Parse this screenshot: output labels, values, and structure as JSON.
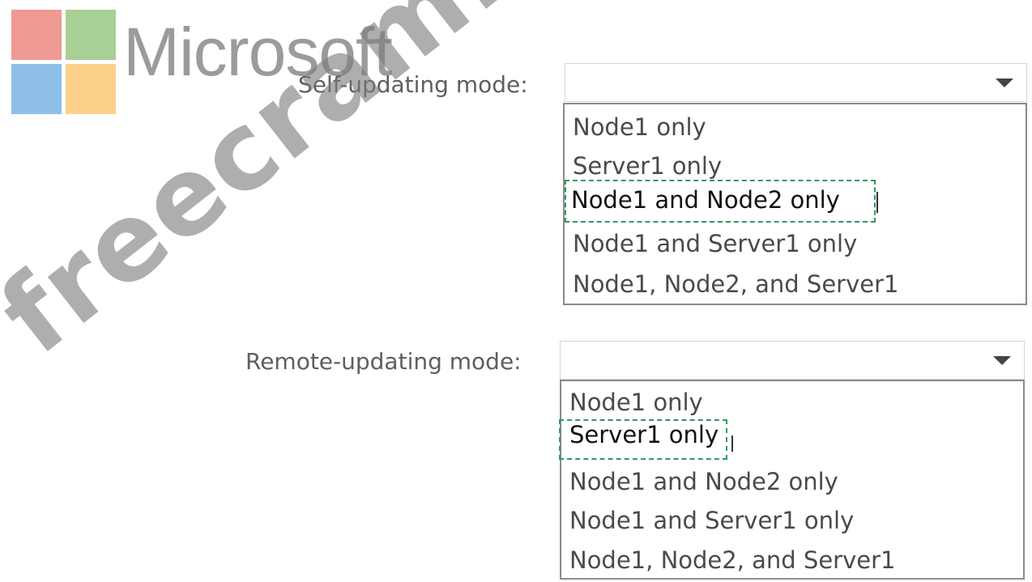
{
  "logo": {
    "text": "Microsoft"
  },
  "watermark": {
    "text": "freecram.net"
  },
  "self_updating": {
    "label": "Self-updating mode:",
    "options": [
      "Node1 only",
      "Server1 only",
      "Node1 and Node2 only",
      "Node1 and Server1 only",
      "Node1, Node2, and Server1"
    ],
    "highlighted": "Node1 and Node2 only"
  },
  "remote_updating": {
    "label": "Remote-updating mode:",
    "options": [
      "Node1 only",
      "Server1 only",
      "Node1 and Node2 only",
      "Node1 and Server1 only",
      "Node1, Node2, and Server1"
    ],
    "highlighted": "Server1 only"
  },
  "colors": {
    "highlight_border": "#2f9b5a",
    "logo_red": "#ef9a94",
    "logo_green": "#a8cf95",
    "logo_blue": "#8fc0ea",
    "logo_yellow": "#fdd08c"
  }
}
